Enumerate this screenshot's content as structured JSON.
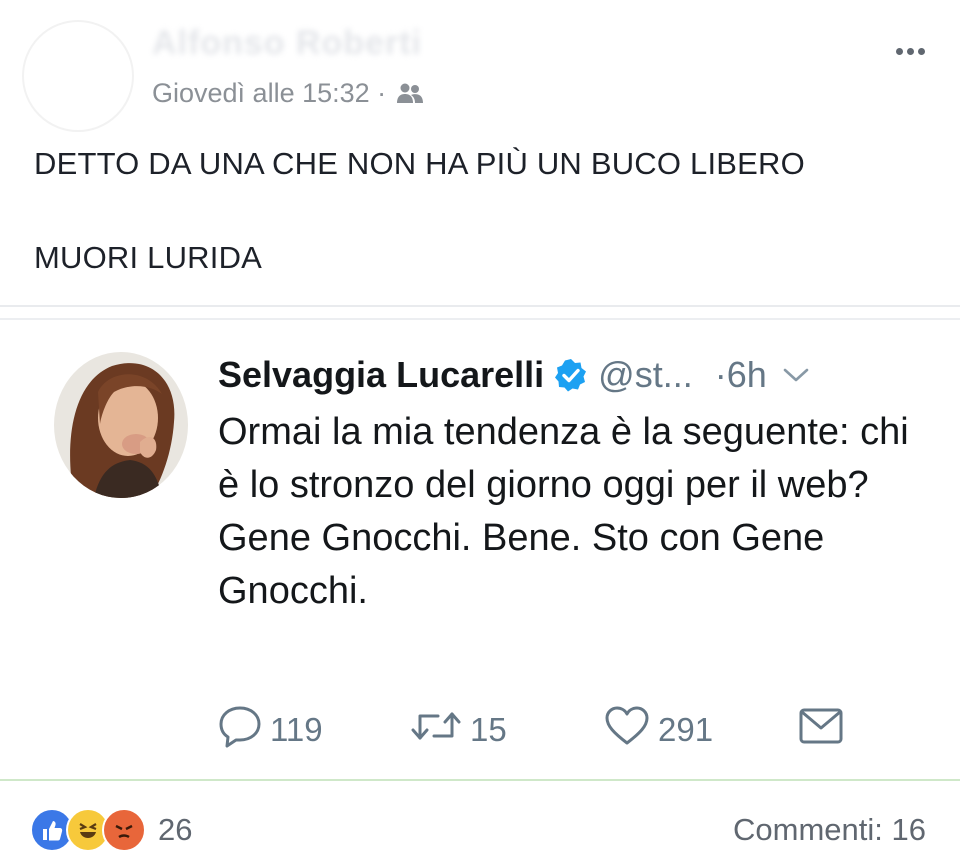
{
  "post": {
    "author_name": "Alfonso Roberti",
    "timestamp": "Giovedì alle 15:32 ·",
    "audience_icon": "friends-icon",
    "more_icon": "more-horizontal-icon",
    "lines": [
      "DETTO DA UNA CHE NON HA PIÙ UN BUCO LIBERO",
      "MUORI LURIDA"
    ]
  },
  "tweet": {
    "name": "Selvaggia Lucarelli",
    "verified_icon": "verified-badge-icon",
    "handle": "@st...",
    "time": "·6h",
    "text": "Ormai la mia tendenza è la seguente: chi è lo stronzo del giorno oggi per il web? Gene Gnocchi. Bene. Sto con Gene Gnocchi.",
    "actions": {
      "replies": "119",
      "retweets": "15",
      "likes": "291"
    },
    "colors": {
      "verified": "#1da1f2",
      "secondary_text": "#657786"
    }
  },
  "footer": {
    "reaction_icons": [
      "like-reaction-icon",
      "haha-reaction-icon",
      "angry-reaction-icon"
    ],
    "reactions_count": "26",
    "comments_label": "Commenti: 16"
  }
}
